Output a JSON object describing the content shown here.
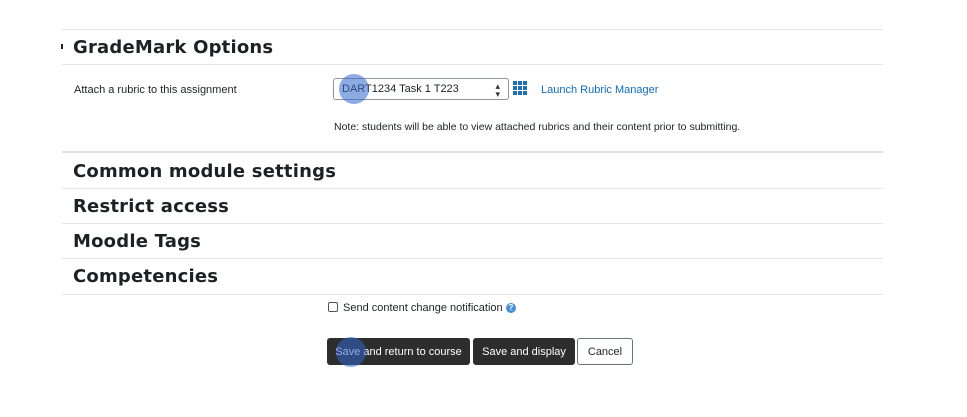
{
  "grademark": {
    "title": "GradeMark Options",
    "rubric_label": "Attach a rubric to this assignment",
    "rubric_selected": "DART1234 Task 1 T223",
    "launch_link": "Launch Rubric Manager",
    "note": "Note: students will be able to view attached rubrics and their content prior to submitting."
  },
  "sections": [
    {
      "title": "Common module settings"
    },
    {
      "title": "Restrict access"
    },
    {
      "title": "Moodle Tags"
    },
    {
      "title": "Competencies"
    }
  ],
  "notification": {
    "label": "Send content change notification",
    "checked": false,
    "help_icon": "question-circle-icon"
  },
  "buttons": {
    "save_return": "Save and return to course",
    "save_display": "Save and display",
    "cancel": "Cancel"
  },
  "icons": {
    "grid": "grid-icon",
    "caret": "select-caret-icon"
  },
  "colors": {
    "link": "#0f6cbf",
    "primary_button": "#2d2d2d",
    "grid_icon": "#1f6fb2",
    "click_indicator": "#3366cc"
  }
}
